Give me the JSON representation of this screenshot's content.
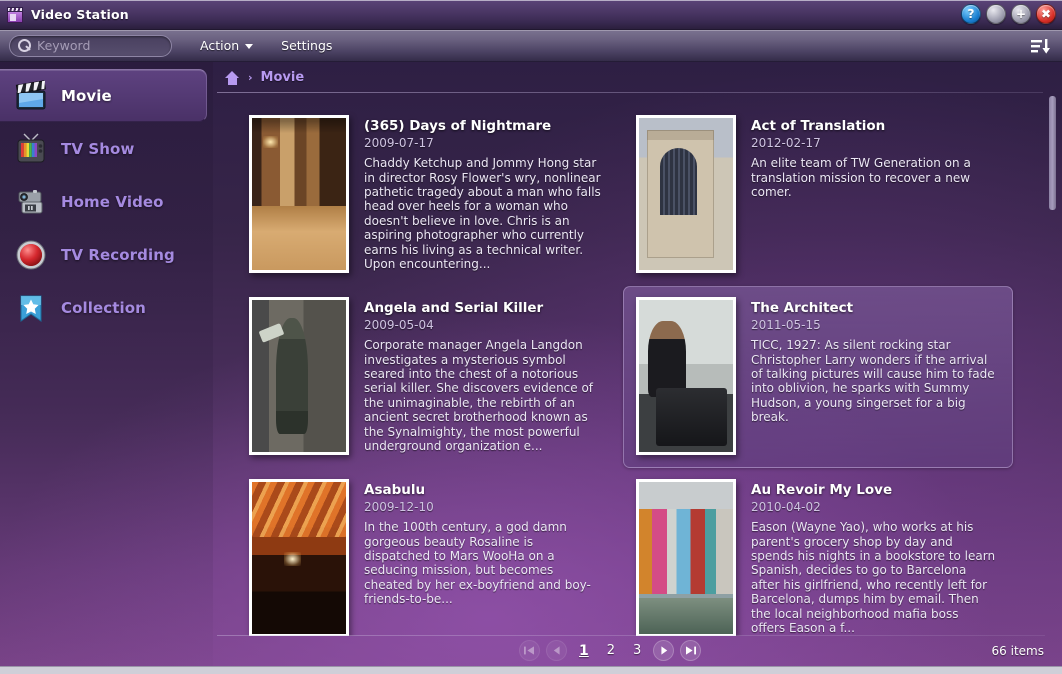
{
  "window": {
    "title": "Video Station",
    "app_icon": "video-station-icon",
    "controls": [
      {
        "name": "help-button",
        "glyph": "?"
      },
      {
        "name": "minimize-button",
        "glyph": ""
      },
      {
        "name": "maximize-button",
        "glyph": "+"
      },
      {
        "name": "close-button",
        "glyph": "✖"
      }
    ]
  },
  "toolbar": {
    "search_placeholder": "Keyword",
    "search_value": "",
    "search_icon": "search-icon",
    "action_label": "Action",
    "settings_label": "Settings",
    "sort_icon": "sort-descending-icon"
  },
  "sidebar": {
    "items": [
      {
        "label": "Movie",
        "icon": "clapperboard-icon",
        "selected": true
      },
      {
        "label": "TV Show",
        "icon": "television-icon",
        "selected": false
      },
      {
        "label": "Home Video",
        "icon": "camcorder-icon",
        "selected": false
      },
      {
        "label": "TV Recording",
        "icon": "record-button-icon",
        "selected": false
      },
      {
        "label": "Collection",
        "icon": "bookmark-star-icon",
        "selected": false
      }
    ]
  },
  "breadcrumb": {
    "home_icon": "home-icon",
    "separator": "›",
    "current": "Movie"
  },
  "movies": [
    {
      "title": "(365) Days of Nightmare",
      "date": "2009-07-17",
      "description": "Chaddy Ketchup and Jommy Hong star in director Rosy Flower's wry, nonlinear pathetic tragedy about a man who falls head over heels for a woman who doesn't believe in love. Chris is an aspiring photographer who currently earns his living as a technical writer. Upon encountering...",
      "poster": "hotel-corridor-photo",
      "selected": false
    },
    {
      "title": "Act of Translation",
      "date": "2012-02-17",
      "description": "An elite team of TW Generation on a translation mission to recover a new comer.",
      "poster": "gothic-cathedral-photo",
      "selected": false
    },
    {
      "title": "Angela and Serial Killer",
      "date": "2009-05-04",
      "description": "Corporate manager Angela Langdon investigates a mysterious symbol seared into the chest of a notorious serial killer. She discovers evidence of the unimaginable, the rebirth of an ancient secret brotherhood known as the Synalmighty, the most powerful underground organization e...",
      "poster": "bronze-statue-photo",
      "selected": false
    },
    {
      "title": "The Architect",
      "date": "2011-05-15",
      "description": "TICC, 1927: As silent rocking star Christopher Larry wonders if the arrival of talking pictures will cause him to fade into oblivion, he sparks with Summy Hudson, a young singerset for a big break.",
      "poster": "man-at-computer-photo",
      "selected": true
    },
    {
      "title": "Asabulu",
      "date": "2009-12-10",
      "description": "In the 100th century, a god damn gorgeous beauty Rosaline is dispatched to Mars WooHa on a seducing mission, but becomes cheated by her ex-boyfriend and boy-friends-to-be...",
      "poster": "opera-hall-photo",
      "selected": false
    },
    {
      "title": "Au Revoir My Love",
      "date": "2010-04-02",
      "description": "Eason (Wayne Yao), who works at his parent's grocery shop by day and spends his nights in a bookstore to learn Spanish, decides to go to Barcelona after his girlfriend, who recently left for Barcelona, dumps him by email. Then the local neighborhood mafia boss offers Eason a f...",
      "poster": "colorful-canal-houses-photo",
      "selected": false
    }
  ],
  "pager": {
    "first_glyph": "I◀",
    "prev_glyph": "‹",
    "next_glyph": "›",
    "last_glyph": "▶I",
    "first_disabled": true,
    "prev_disabled": true,
    "pages": [
      "1",
      "2",
      "3"
    ],
    "current_page": "1",
    "items_count": "66 items"
  }
}
